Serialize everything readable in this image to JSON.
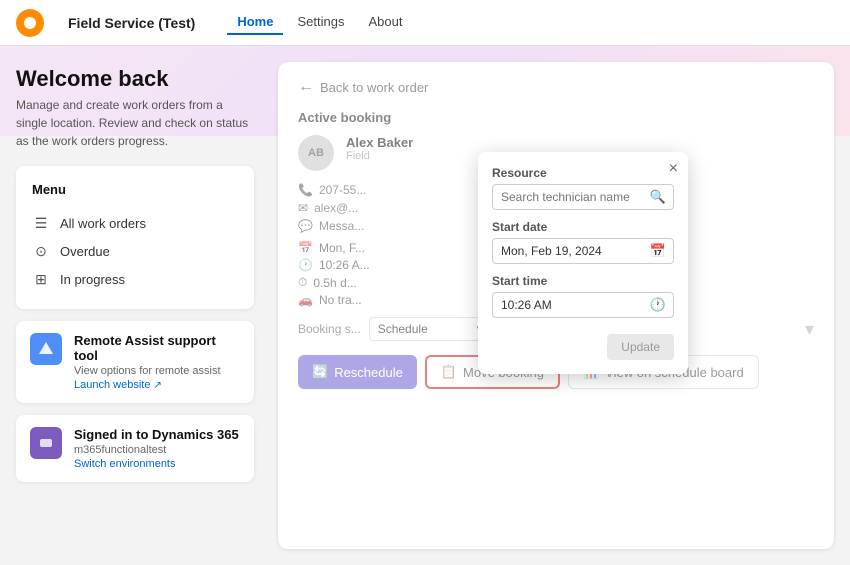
{
  "nav": {
    "logo_alt": "Field Service logo",
    "app_name": "Field Service (Test)",
    "links": [
      {
        "label": "Home",
        "active": true
      },
      {
        "label": "Settings",
        "active": false
      },
      {
        "label": "About",
        "active": false
      }
    ]
  },
  "welcome": {
    "title": "Welcome back",
    "description": "Manage and create work orders from a single location. Review and check on status as the work orders progress."
  },
  "menu": {
    "title": "Menu",
    "items": [
      {
        "label": "All work orders",
        "icon": "📋"
      },
      {
        "label": "Overdue",
        "icon": "⏰"
      },
      {
        "label": "In progress",
        "icon": "🔄"
      }
    ]
  },
  "remote_assist": {
    "name": "Remote Assist support tool",
    "desc": "View options for remote assist",
    "link": "Launch website"
  },
  "dynamics": {
    "name": "Signed in to Dynamics 365",
    "user": "m365functionaltest",
    "link": "Switch environments"
  },
  "work_order": {
    "back_label": "Back to work order",
    "active_booking_label": "Active booking",
    "technician_name": "Alex Baker",
    "technician_role": "Field",
    "avatar_initials": "AB",
    "phone": "207-55...",
    "email": "alex@...",
    "message": "Messa...",
    "schedule_date": "Mon, F...",
    "schedule_time": "10:26 A...",
    "duration": "0.5h d...",
    "travel": "No tra...",
    "booking_status_label": "Booking s...",
    "status_value": "Schedule",
    "update_label": "Update",
    "btn_reschedule": "Reschedule",
    "btn_move": "Move booking",
    "btn_board": "View on schedule board"
  },
  "modal": {
    "resource_label": "Resource",
    "search_placeholder": "Search technician name",
    "start_date_label": "Start date",
    "start_date_value": "Mon, Feb 19, 2024",
    "start_time_label": "Start time",
    "start_time_value": "10:26 AM",
    "update_btn": "Update",
    "close_icon": "×"
  }
}
